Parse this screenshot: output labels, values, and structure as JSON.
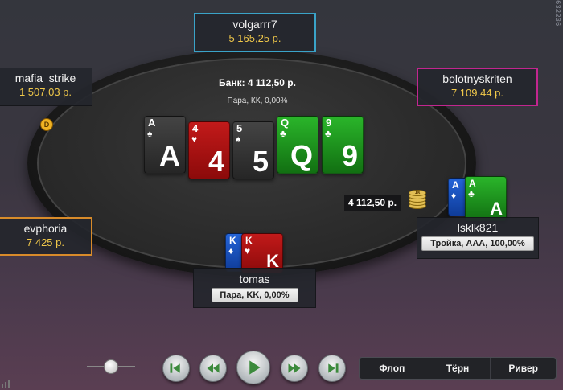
{
  "side_id": "632236",
  "pot": {
    "label": "Банк: 4 112,50 р.",
    "sub": "Пара, КК, 0,00%"
  },
  "seats": {
    "top": {
      "name": "volgarrr7",
      "stack": "5 165,25 р."
    },
    "left": {
      "name": "mafia_strike",
      "stack": "1 507,03 р."
    },
    "right": {
      "name": "bolotnyskriten",
      "stack": "7 109,44 р."
    },
    "lowleft": {
      "name": "evphoria",
      "stack": "7 425 р."
    },
    "hero": {
      "name": "tomas",
      "hand": "Пара, KK, 0,00%"
    },
    "lk": {
      "name": "lsklk821",
      "hand": "Тройка, AAA, 100,00%"
    }
  },
  "dealer_label": "D",
  "board": [
    {
      "rank": "A",
      "suit": "♠",
      "color": "black"
    },
    {
      "rank": "4",
      "suit": "♥",
      "color": "red"
    },
    {
      "rank": "5",
      "suit": "♠",
      "color": "black"
    },
    {
      "rank": "Q",
      "suit": "♣",
      "color": "green"
    },
    {
      "rank": "9",
      "suit": "♣",
      "color": "green"
    }
  ],
  "hero_cards": [
    {
      "rank": "K",
      "suit": "♦",
      "color": "blue"
    },
    {
      "rank": "K",
      "suit": "♥",
      "color": "red"
    }
  ],
  "lk_cards": [
    {
      "rank": "A",
      "suit": "♦",
      "color": "blue"
    },
    {
      "rank": "A",
      "suit": "♣",
      "color": "green"
    }
  ],
  "bet": {
    "amount": "4 112,50 р.",
    "chip_label": "1k"
  },
  "streets": [
    "Флоп",
    "Тёрн",
    "Ривер"
  ],
  "colors": {
    "top_border": "#3aa3c8",
    "right_border": "#c2268f",
    "lowleft_border": "#d88b2a",
    "stack_gold": "#f0c84a"
  },
  "icons": [
    "rewind-to-start-icon",
    "step-back-icon",
    "play-icon",
    "step-forward-icon",
    "skip-to-end-icon",
    "signal-bars-icon"
  ]
}
